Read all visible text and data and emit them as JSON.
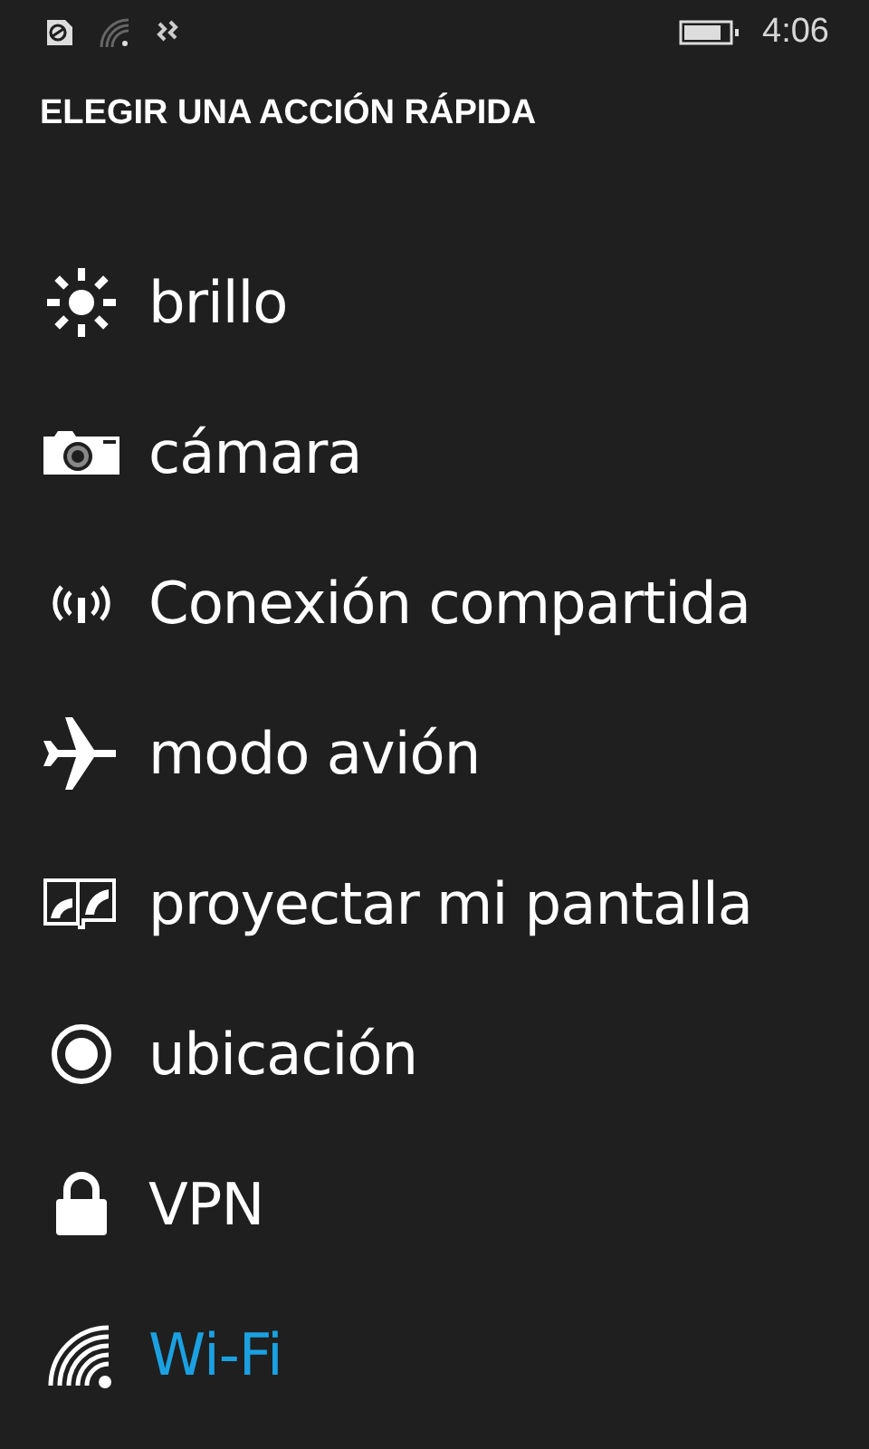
{
  "status_bar": {
    "time": "4:06"
  },
  "title": "ELEGIR UNA ACCIÓN RÁPIDA",
  "actions": [
    {
      "kind": "brightness",
      "label": "brillo",
      "selected": false
    },
    {
      "kind": "camera",
      "label": "cámara",
      "selected": false
    },
    {
      "kind": "hotspot",
      "label": "Conexión compartida",
      "selected": false
    },
    {
      "kind": "airplane",
      "label": "modo avión",
      "selected": false
    },
    {
      "kind": "project",
      "label": "proyectar mi pantalla",
      "selected": false
    },
    {
      "kind": "location",
      "label": "ubicación",
      "selected": false
    },
    {
      "kind": "vpn",
      "label": "VPN",
      "selected": false
    },
    {
      "kind": "wifi",
      "label": "Wi-Fi",
      "selected": true
    }
  ]
}
